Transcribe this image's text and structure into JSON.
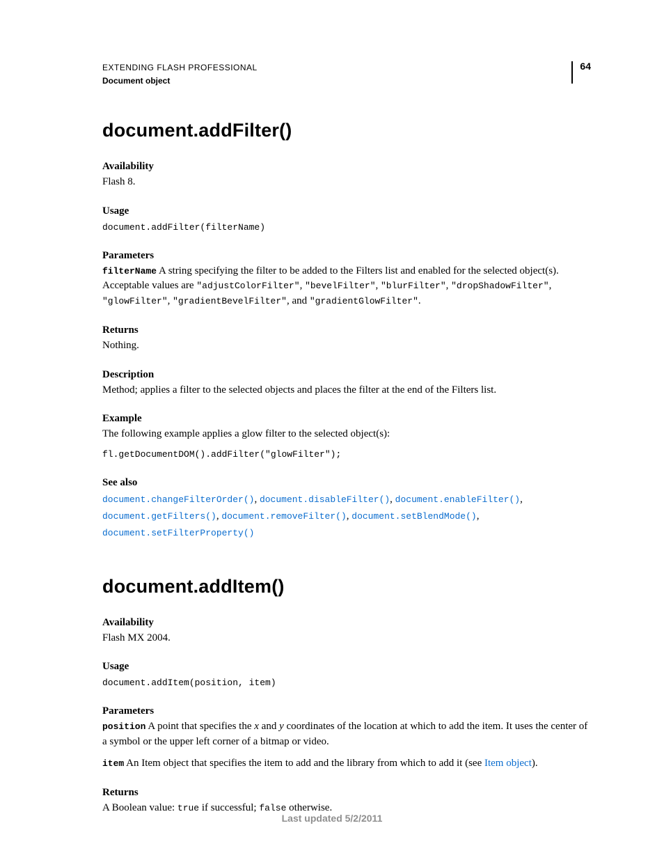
{
  "header": {
    "line1": "EXTENDING FLASH PROFESSIONAL",
    "line2": "Document object",
    "page_number": "64"
  },
  "footer": {
    "text": "Last updated 5/2/2011"
  },
  "sections": [
    {
      "title": "document.addFilter()",
      "availability": {
        "label": "Availability",
        "text": "Flash 8."
      },
      "usage": {
        "label": "Usage",
        "code": "document.addFilter(filterName)"
      },
      "parameters": {
        "label": "Parameters",
        "param_name": "filterName",
        "p1_a": " A string specifying the filter to be added to the Filters list and enabled for the selected object(s). Acceptable values are ",
        "v1": "\"adjustColorFilter\"",
        "c1": ",  ",
        "v2": "\"bevelFilter\"",
        "c2": ", ",
        "v3": "\"blurFilter\"",
        "c3": ", ",
        "v4": "\"dropShadowFilter\"",
        "c4": ", ",
        "v5": "\"glowFilter\"",
        "c5": ", ",
        "v6": "\"gradientBevelFilter\"",
        "c6": ", and ",
        "v7": "\"gradientGlowFilter\"",
        "c7": "."
      },
      "returns": {
        "label": "Returns",
        "text": "Nothing."
      },
      "description": {
        "label": "Description",
        "text": "Method; applies a filter to the selected objects and places the filter at the end of the Filters list."
      },
      "example": {
        "label": "Example",
        "text": "The following example applies a glow filter to the selected object(s):",
        "code": "fl.getDocumentDOM().addFilter(\"glowFilter\");"
      },
      "see_also": {
        "label": "See also",
        "links": [
          "document.changeFilterOrder()",
          "document.disableFilter()",
          "document.enableFilter()",
          "document.getFilters()",
          "document.removeFilter()",
          "document.setBlendMode()",
          "document.setFilterProperty()"
        ],
        "sep": ", "
      }
    },
    {
      "title": "document.addItem()",
      "availability": {
        "label": "Availability",
        "text": "Flash MX 2004."
      },
      "usage": {
        "label": "Usage",
        "code": "document.addItem(position, item)"
      },
      "parameters": {
        "label": "Parameters",
        "p1_name": "position",
        "p1_a": " A point that specifies the ",
        "p1_x": "x",
        "p1_b": " and ",
        "p1_y": "y",
        "p1_c": " coordinates of the location at which to add the item. It uses the center of a symbol or the upper left corner of a bitmap or video.",
        "p2_name": "item",
        "p2_a": " An Item object that specifies the item to add and the library from which to add it (see ",
        "p2_link": "Item object",
        "p2_b": ")."
      },
      "returns": {
        "label": "Returns",
        "a": "A Boolean value: ",
        "true": "true",
        "b": " if successful; ",
        "false": "false",
        "c": " otherwise."
      }
    }
  ]
}
